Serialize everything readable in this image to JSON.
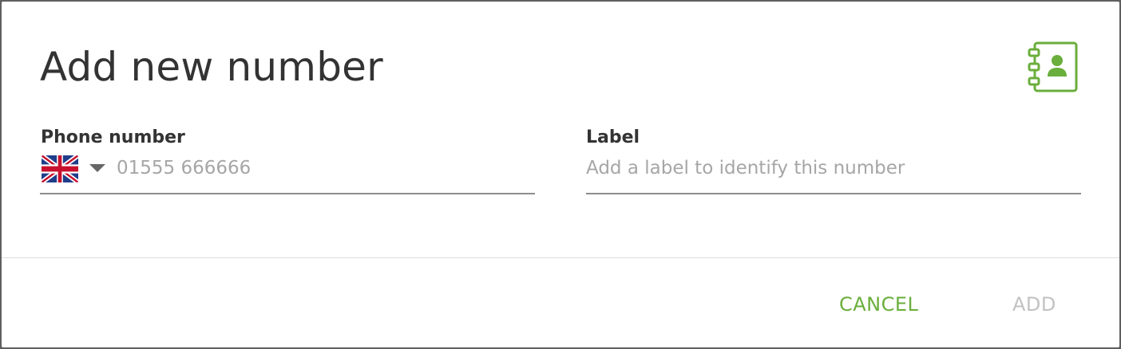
{
  "dialog": {
    "title": "Add new number",
    "contacts_icon": "address-book-icon",
    "accent_color": "#6aae3c"
  },
  "phone": {
    "label": "Phone number",
    "country_flag": "uk-flag-icon",
    "country_dropdown_icon": "caret-down-icon",
    "value": "",
    "placeholder": "01555 666666"
  },
  "label_field": {
    "label": "Label",
    "value": "",
    "placeholder": "Add a label to identify this number"
  },
  "actions": {
    "cancel_label": "CANCEL",
    "add_label": "ADD",
    "add_disabled": true
  }
}
